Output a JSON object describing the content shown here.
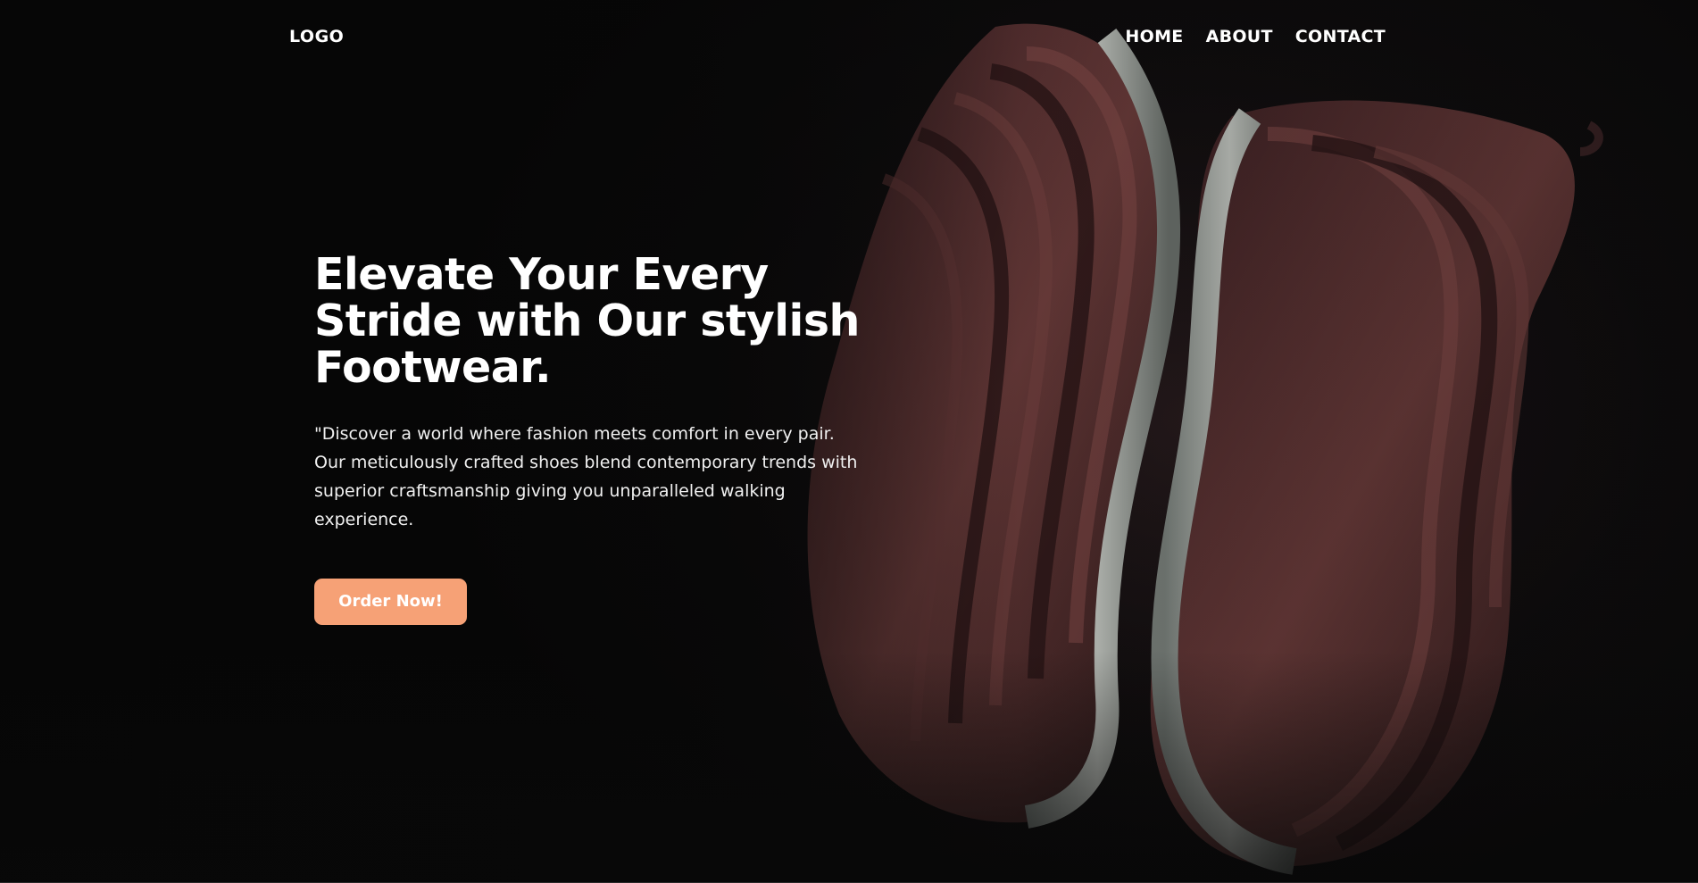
{
  "nav": {
    "logo": "LOGO",
    "links": [
      "HOME",
      "ABOUT",
      "CONTACT"
    ]
  },
  "hero": {
    "headline_lines": [
      "Elevate Your Every",
      "Stride with Our stylish",
      "Footwear."
    ],
    "description": "\"Discover a world where fashion meets comfort in every pair. Our meticulously crafted shoes blend contemporary trends with superior craftsmanship giving you unparalleled walking experience.",
    "cta_label": "Order Now!",
    "background_image": "shoes-photo"
  },
  "colors": {
    "background": "#0b0a0b",
    "text": "#ffffff",
    "accent": "#f6a176",
    "shoe_bronze": "#6b3a3a",
    "shoe_sole": "#c9ccc6"
  }
}
